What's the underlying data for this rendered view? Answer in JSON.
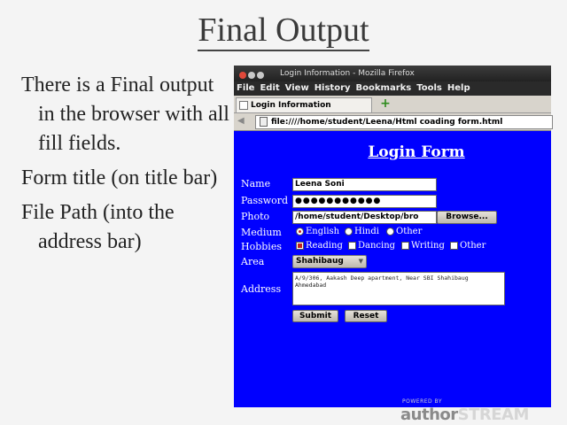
{
  "slide": {
    "title": "Final Output",
    "bullets": [
      "There is a Final output in the browser with all fill fields.",
      "Form title (on title bar)",
      "File Path (into the address bar)"
    ]
  },
  "browser": {
    "window_title": "Login Information - Mozilla Firefox",
    "menu": [
      "File",
      "Edit",
      "View",
      "History",
      "Bookmarks",
      "Tools",
      "Help"
    ],
    "tab_label": "Login Information",
    "new_tab_glyph": "+",
    "url": "file:////home/student/Leena/Html coading form.html"
  },
  "form": {
    "title": "Login Form",
    "labels": {
      "name": "Name",
      "password": "Password",
      "photo": "Photo",
      "medium": "Medium",
      "hobbies": "Hobbies",
      "area": "Area",
      "address": "Address"
    },
    "name_value": "Leena Soni",
    "password_value": "●●●●●●●●●●●",
    "photo_path": "/home/student/Desktop/bro",
    "browse_label": "Browse...",
    "medium_options": [
      {
        "label": "English",
        "selected": true
      },
      {
        "label": "Hindi",
        "selected": false
      },
      {
        "label": "Other",
        "selected": false
      }
    ],
    "hobby_options": [
      {
        "label": "Reading",
        "checked": true
      },
      {
        "label": "Dancing",
        "checked": false
      },
      {
        "label": "Writing",
        "checked": false
      },
      {
        "label": "Other",
        "checked": false
      }
    ],
    "area_selected": "Shahibaug",
    "address_value": "A/9/306, Aakash Deep apartment, Near SBI Shahibaug Ahmedabad",
    "submit_label": "Submit",
    "reset_label": "Reset"
  },
  "watermark": {
    "powered_by": "POWERED BY",
    "brand_a": "author",
    "brand_b": "STREAM"
  },
  "colors": {
    "page_background": "#0000ff",
    "title_bar": "#2a2a2a",
    "radio_selected": "#c02020"
  }
}
